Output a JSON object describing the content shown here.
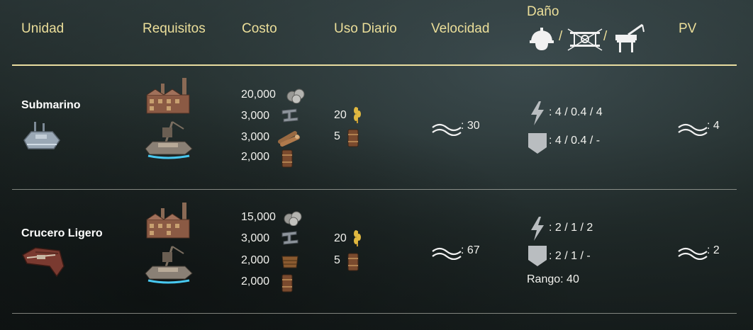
{
  "headers": {
    "unidad": "Unidad",
    "requisitos": "Requisitos",
    "costo": "Costo",
    "uso_diario": "Uso Diario",
    "velocidad": "Velocidad",
    "dano": "Daño",
    "dano_sep1": "/",
    "dano_sep2": "/",
    "pv": "PV"
  },
  "rows": [
    {
      "name": "Submarino",
      "costs": [
        "20,000",
        "3,000",
        "3,000",
        "2,000"
      ],
      "daily": [
        "20",
        "5"
      ],
      "speed": ": 30",
      "attack": ": 4 / 0.4 / 4",
      "defense": ": 4 / 0.4 / -",
      "hp": ": 4"
    },
    {
      "name": "Crucero Ligero",
      "costs": [
        "15,000",
        "3,000",
        "2,000",
        "2,000"
      ],
      "daily": [
        "20",
        "5"
      ],
      "speed": ": 67",
      "attack": ": 2 / 1 / 2",
      "defense": ": 2 / 1 / -",
      "range": "Rango: 40",
      "hp": ": 2"
    }
  ],
  "colors": {
    "header": "#ecdf9a",
    "text": "#f2f2ee",
    "divider": "#e9dda0"
  }
}
